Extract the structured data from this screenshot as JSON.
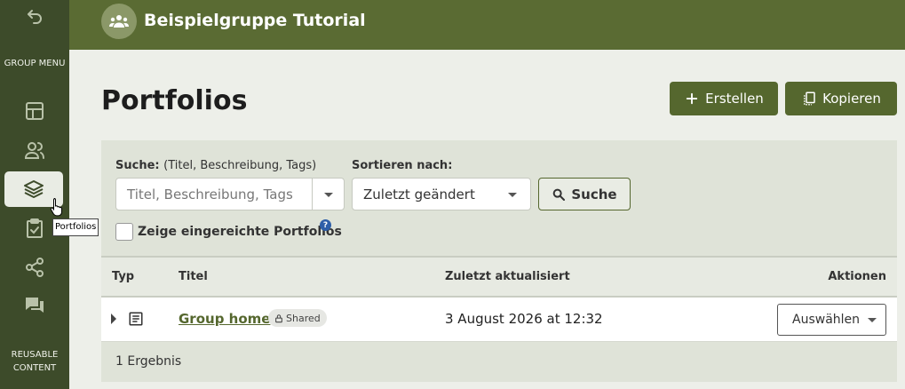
{
  "sidebar": {
    "back_icon": "undo-arrow-icon",
    "group_menu_label": "GROUP MENU",
    "items": [
      {
        "icon": "layout-icon"
      },
      {
        "icon": "users-icon"
      },
      {
        "icon": "layers-icon",
        "active": true
      },
      {
        "icon": "clipboard-check-icon"
      },
      {
        "icon": "share-icon"
      },
      {
        "icon": "chat-icon"
      }
    ],
    "reusable_content_label": "REUSABLE CONTENT",
    "tooltip": "Portfolios"
  },
  "header": {
    "group_title": "Beispielgruppe Tutorial",
    "avatar_icon": "group-icon"
  },
  "page": {
    "title": "Portfolios",
    "create_label": "Erstellen",
    "copy_label": "Kopieren"
  },
  "search": {
    "label_bold": "Suche:",
    "label_light": "(Titel, Beschreibung, Tags)",
    "placeholder": "Titel, Beschreibung, Tags",
    "sort_label": "Sortieren nach:",
    "sort_value": "Zuletzt geändert",
    "search_button": "Suche",
    "show_submitted": "Zeige eingereichte Portfolios",
    "help": "?"
  },
  "table": {
    "headers": {
      "type": "Typ",
      "title": "Titel",
      "updated": "Zuletzt aktualisiert",
      "actions": "Aktionen"
    },
    "rows": [
      {
        "title": "Group home",
        "badge": "Shared",
        "updated": "3 August 2026 at 12:32",
        "action": "Auswählen"
      }
    ],
    "footer": "1 Ergebnis"
  },
  "colors": {
    "sidebar": "#3d4b2a",
    "header": "#5a6b33",
    "accent": "#55672e"
  }
}
